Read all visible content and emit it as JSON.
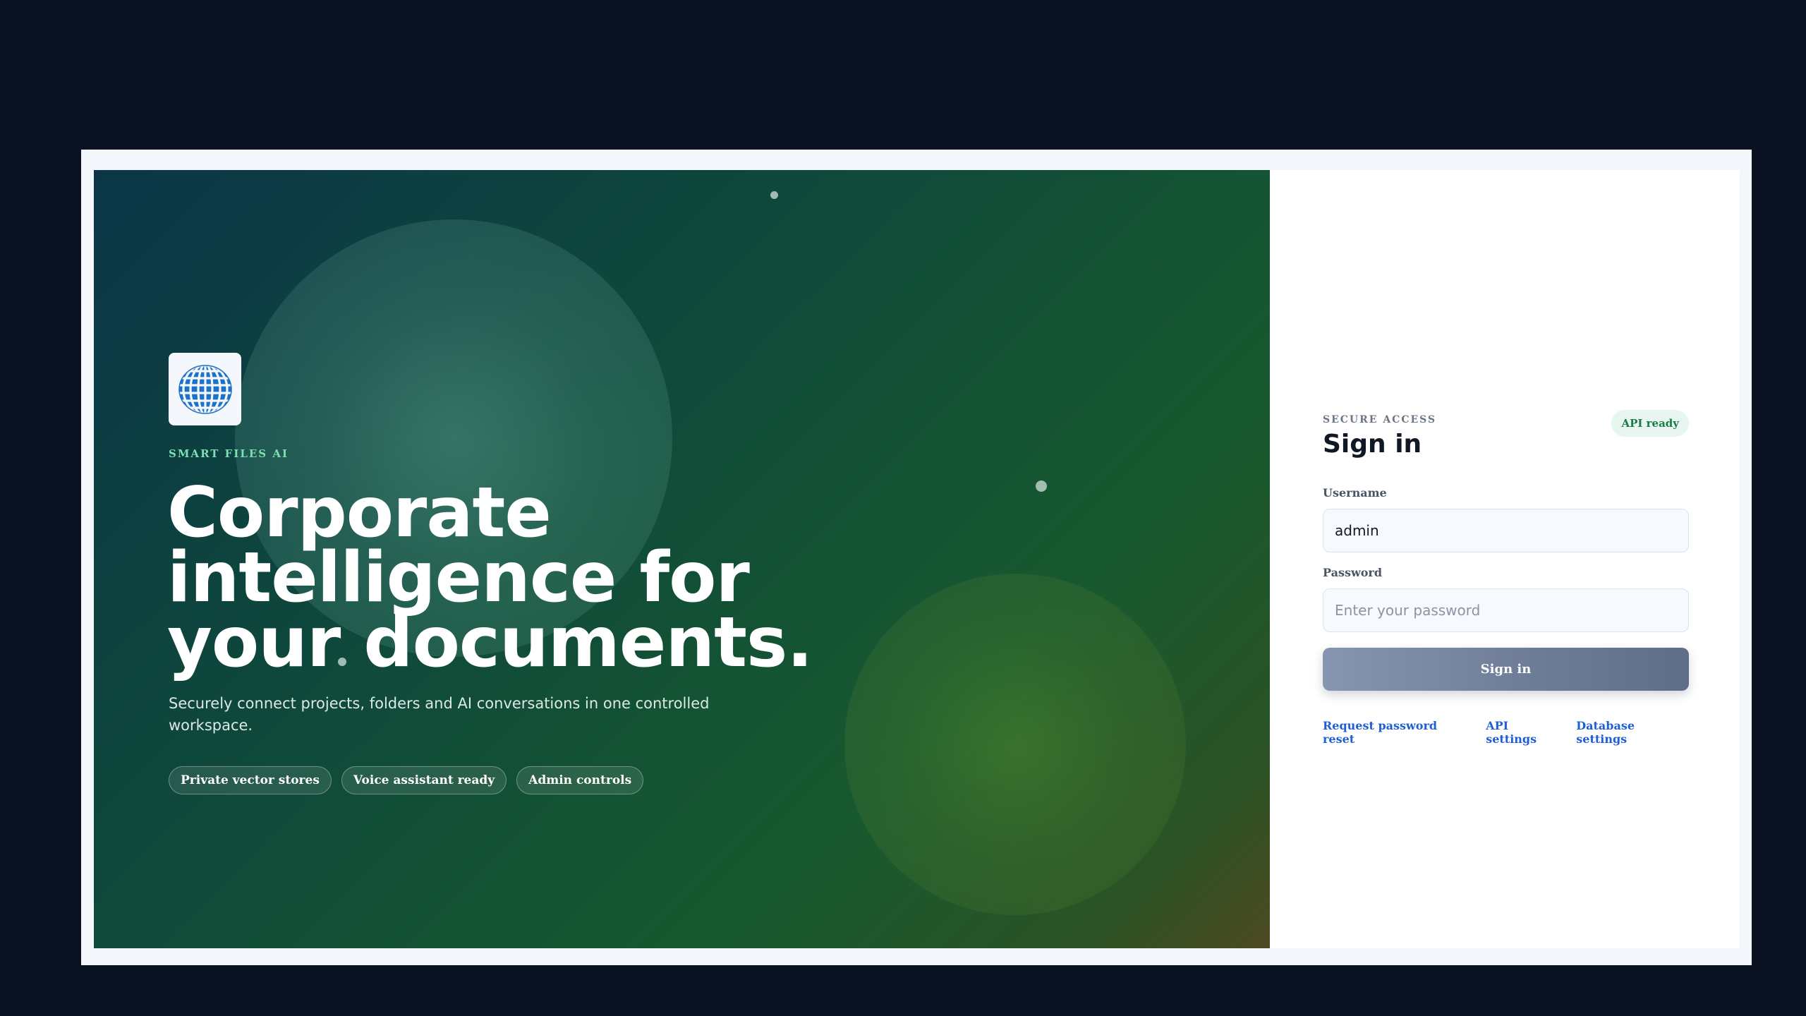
{
  "hero": {
    "brand": "SMART FILES AI",
    "headline": "Corporate intelligence for your documents.",
    "subtitle": "Securely connect projects, folders and AI conversations in one controlled workspace.",
    "tags": [
      "Private vector stores",
      "Voice assistant ready",
      "Admin controls"
    ],
    "logo_icon": "globe-icon"
  },
  "form": {
    "eyebrow": "SECURE ACCESS",
    "title": "Sign in",
    "status_badge": "API ready",
    "username_label": "Username",
    "username_value": "admin",
    "password_label": "Password",
    "password_placeholder": "Enter your password",
    "submit_label": "Sign in",
    "links": [
      "Request password reset",
      "API settings",
      "Database settings"
    ]
  },
  "colors": {
    "accent_link": "#1f5fd6",
    "brand_green": "#7ee0b0",
    "badge_green": "#1a7a4a"
  }
}
